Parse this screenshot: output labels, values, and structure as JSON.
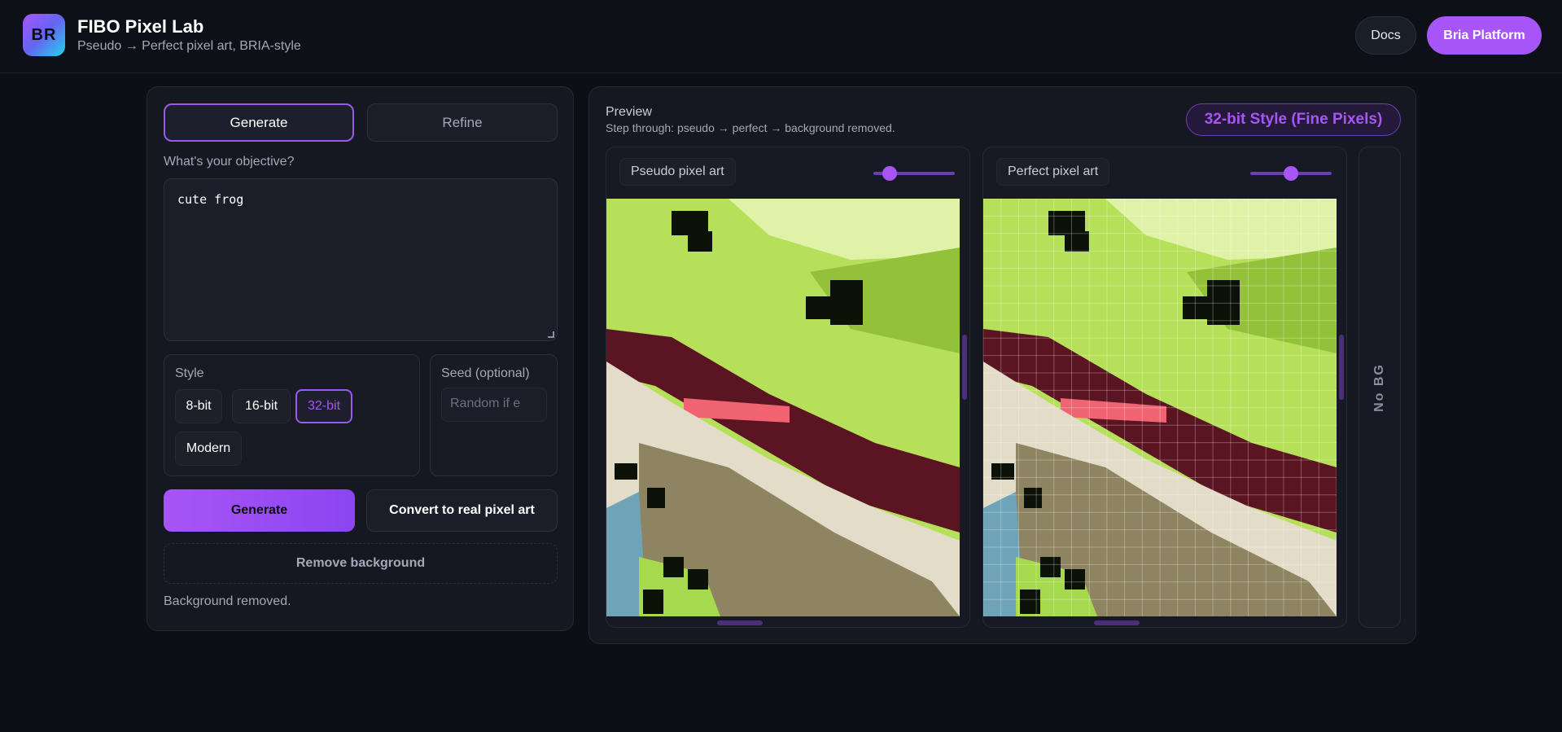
{
  "header": {
    "logo_text": "BR",
    "title": "FIBO Pixel Lab",
    "subtitle": "Pseudo → Perfect pixel art, BRIA-style",
    "docs_label": "Docs",
    "platform_label": "Bria Platform"
  },
  "left": {
    "tabs": [
      {
        "label": "Generate",
        "active": true
      },
      {
        "label": "Refine",
        "active": false
      }
    ],
    "objective_label": "What's your objective?",
    "prompt_value": "cute frog",
    "style_label": "Style",
    "style_options": [
      "8-bit",
      "16-bit",
      "32-bit",
      "Modern"
    ],
    "style_selected": "32-bit",
    "seed_label": "Seed (optional)",
    "seed_placeholder": "Random if e",
    "generate_label": "Generate",
    "convert_label": "Convert to real pixel art",
    "remove_bg_label": "Remove background",
    "status": "Background removed."
  },
  "preview": {
    "title": "Preview",
    "subtitle": "Step through: pseudo → perfect → background removed.",
    "style_badge": "32-bit Style (Fine Pixels)",
    "cards": [
      {
        "label": "Pseudo pixel art",
        "slider_value": 0.2
      },
      {
        "label": "Perfect pixel art",
        "slider_value": 0.5
      }
    ],
    "nobg_label": "No BG"
  },
  "colors": {
    "accent": "#a855f7",
    "background": "#0d0f15",
    "panel": "#151821"
  }
}
